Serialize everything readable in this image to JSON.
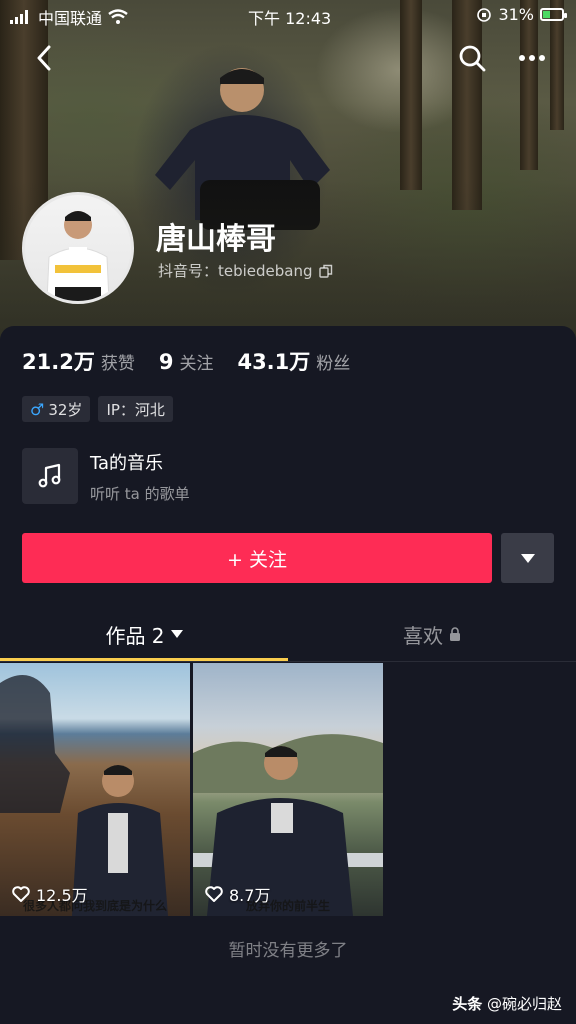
{
  "status_bar": {
    "carrier": "中国联通",
    "time": "下午 12:43",
    "battery": "31%"
  },
  "header": {
    "back_icon": "chevron-left-icon",
    "search_icon": "search-icon",
    "more_icon": "more-horizontal-icon"
  },
  "profile": {
    "name": "唐山棒哥",
    "id_label": "抖音号：tebiedebang",
    "copy_icon": "copy-icon"
  },
  "stats": [
    {
      "num": "21.2万",
      "label": "获赞"
    },
    {
      "num": "9",
      "label": "关注"
    },
    {
      "num": "43.1万",
      "label": "粉丝"
    }
  ],
  "tags": {
    "age": "32岁",
    "ip": "IP：河北",
    "gender_icon": "male-icon"
  },
  "music": {
    "title": "Ta的音乐",
    "subtitle": "听听 ta 的歌单",
    "icon": "music-note-icon"
  },
  "actions": {
    "follow_label": "+ 关注",
    "dropdown_icon": "caret-down-icon"
  },
  "tabs": {
    "works": "作品 2",
    "likes": "喜欢"
  },
  "videos": [
    {
      "likes": "12.5万",
      "caption": "很多人都问我到底是为什么"
    },
    {
      "likes": "8.7万",
      "caption": "放弃你的前半生"
    }
  ],
  "footer": {
    "no_more": "暂时没有更多了",
    "watermark_brand": "头条",
    "watermark_user": "@碗必归赵"
  },
  "colors": {
    "accent": "#fe2c55",
    "tab_indicator": "#facd4e",
    "background": "#161823"
  }
}
